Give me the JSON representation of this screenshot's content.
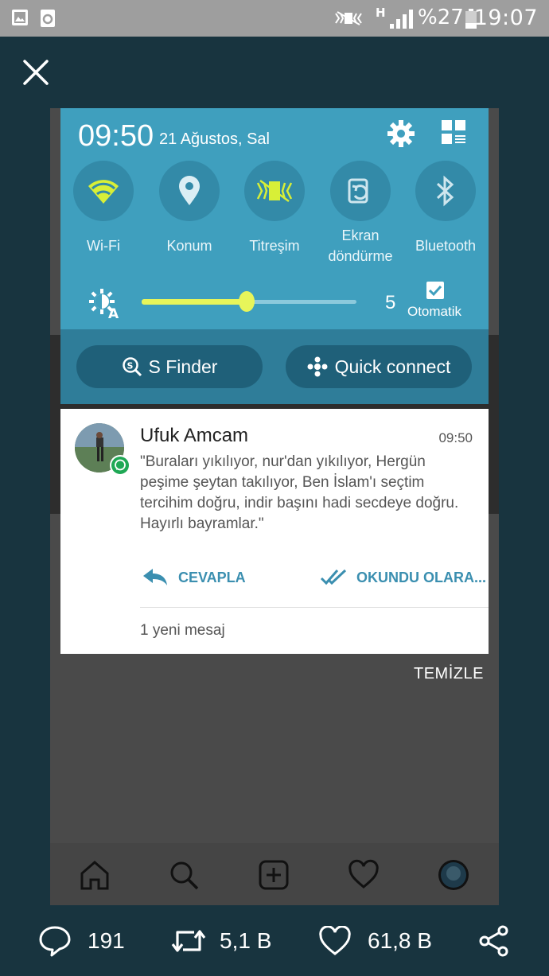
{
  "status_bar": {
    "battery_percent": "%27",
    "time": "19:07",
    "network": "H",
    "icons": [
      "gallery-icon",
      "recycle-icon",
      "vibrate-icon",
      "signal-icon",
      "battery-icon"
    ]
  },
  "panel": {
    "clock": "09:50",
    "date": "21 Ağustos, Sal",
    "quick_settings": [
      {
        "label": "Wi-Fi",
        "icon": "wifi-icon",
        "active": true
      },
      {
        "label": "Konum",
        "icon": "location-icon",
        "active": false
      },
      {
        "label": "Titreşim",
        "icon": "vibrate-icon",
        "active": true
      },
      {
        "label": "Ekran\ndöndürme",
        "icon": "rotate-icon",
        "active": false
      },
      {
        "label": "Bluetooth",
        "icon": "bluetooth-icon",
        "active": false
      }
    ],
    "brightness": {
      "value": "5",
      "level": 0.49,
      "auto_label": "Otomatik",
      "auto_checked": true
    },
    "s_finder": "S Finder",
    "quick_connect": "Quick connect"
  },
  "notification": {
    "sender": "Ufuk Amcam",
    "time": "09:50",
    "message": "\"Buraları yıkılıyor, nur'dan yıkılıyor, Hergün peşime şeytan takılıyor, Ben İslam'ı seçtim tercihim doğru, indir başını hadi secdeye doğru. Hayırlı bayramlar.\"",
    "reply": "CEVAPLA",
    "mark_read": "OKUNDU OLARA...",
    "new_messages": "1 yeni mesaj"
  },
  "clear": "TEMİZLE",
  "stats": {
    "replies": "191",
    "retweets": "5,1 B",
    "likes": "61,8 B"
  },
  "colors": {
    "panel": "#3f9fbe",
    "accent": "#e7f55a",
    "link": "#3b8fb0",
    "background": "#18343f"
  }
}
